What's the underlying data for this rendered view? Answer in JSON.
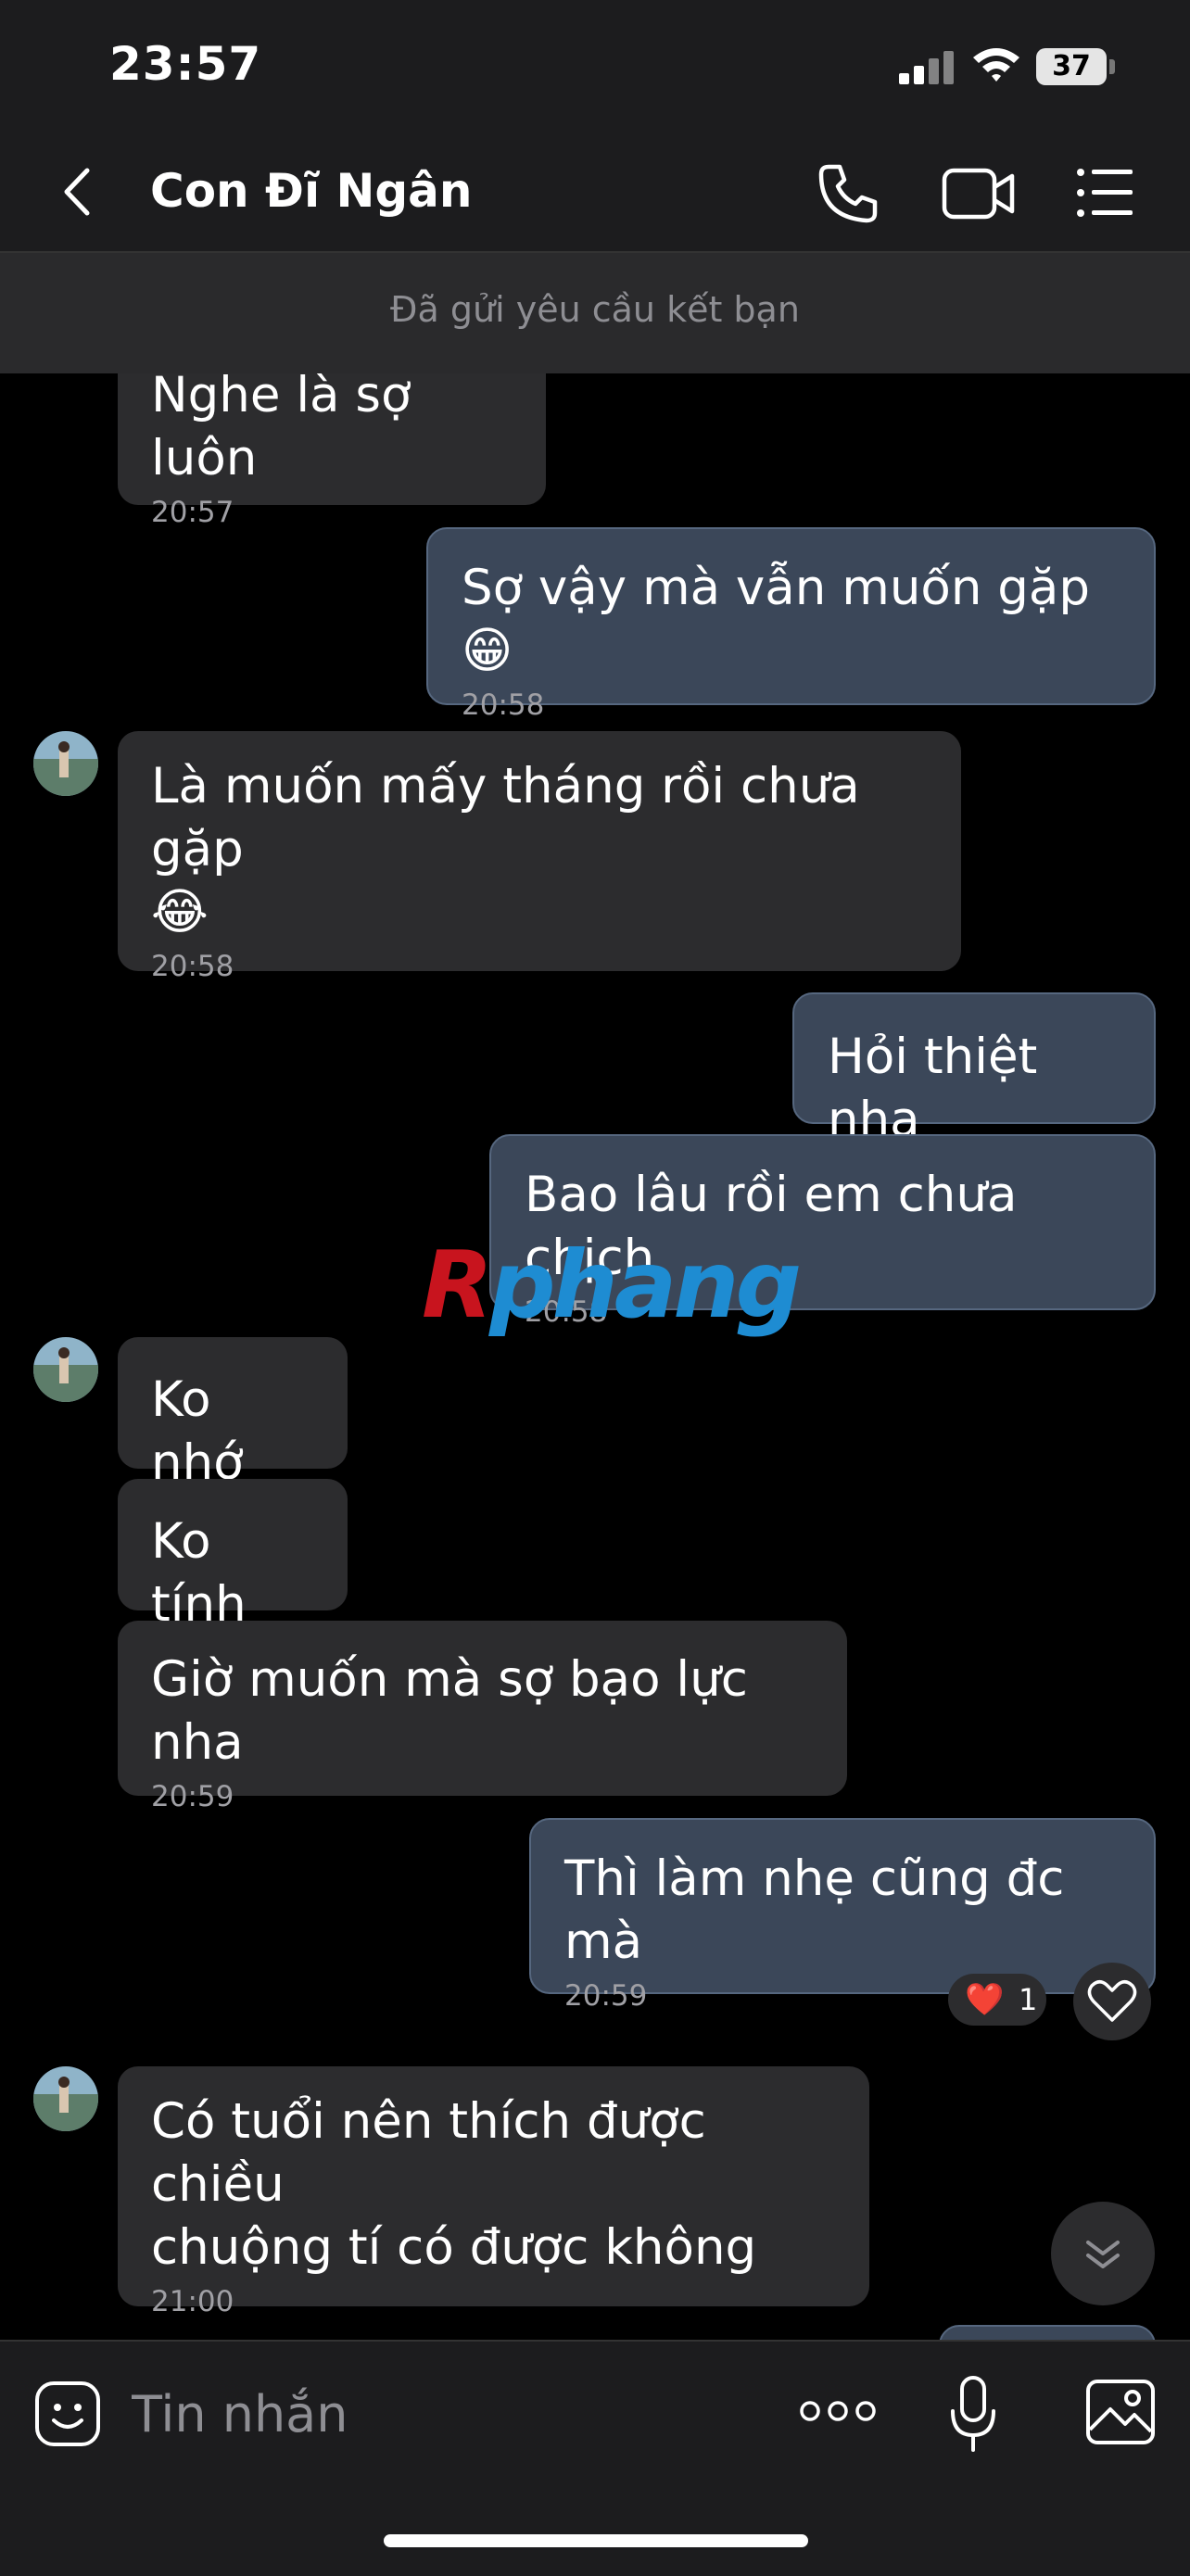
{
  "status_bar": {
    "time": "23:57",
    "battery": "37"
  },
  "header": {
    "contact_name": "Con Đĩ Ngân"
  },
  "banner": {
    "friend_request": "Đã gửi yêu cầu kết bạn"
  },
  "messages": [
    {
      "direction": "in",
      "text": "Nghe là sợ luôn",
      "time": "20:57"
    },
    {
      "direction": "out",
      "text": "Sợ vậy mà vẫn muốn gặp 😁",
      "time": "20:58"
    },
    {
      "direction": "in",
      "text": "Là muốn mấy tháng rồi chưa gặp\n😂",
      "time": "20:58"
    },
    {
      "direction": "out",
      "text": "Hỏi thiệt nha",
      "time": ""
    },
    {
      "direction": "out",
      "text": "Bao lâu rồi em chưa chịch",
      "time": "20:58"
    },
    {
      "direction": "in",
      "text": "Ko nhớ",
      "time": ""
    },
    {
      "direction": "in",
      "text": "Ko tính",
      "time": ""
    },
    {
      "direction": "in",
      "text": "Giờ muốn mà sợ bạo lực nha",
      "time": "20:59"
    },
    {
      "direction": "out",
      "text": "Thì làm nhẹ cũng đc mà",
      "time": "20:59"
    },
    {
      "direction": "in",
      "text": "Có tuổi nên thích được chiều\nchuộng tí có được không",
      "time": "21:00"
    }
  ],
  "reaction": {
    "emoji": "❤️",
    "count": "1"
  },
  "watermark": {
    "part1": "R",
    "part2": "phang"
  },
  "input": {
    "placeholder": "Tin nhắn"
  },
  "icons": {
    "back": "chevron-left-icon",
    "call": "phone-icon",
    "video": "video-camera-icon",
    "menu": "list-icon",
    "sticker": "smiley-icon",
    "more": "ellipsis-icon",
    "mic": "microphone-icon",
    "image": "image-icon",
    "like": "heart-outline-icon",
    "scroll": "chevron-double-down-icon"
  },
  "colors": {
    "background": "#000000",
    "bar": "#1c1c1e",
    "incoming_bubble": "#2c2c2e",
    "outgoing_bubble": "#3b4759",
    "outgoing_border": "#56677f",
    "watermark_red": "#c8141e",
    "watermark_blue": "#1e8cd2"
  }
}
